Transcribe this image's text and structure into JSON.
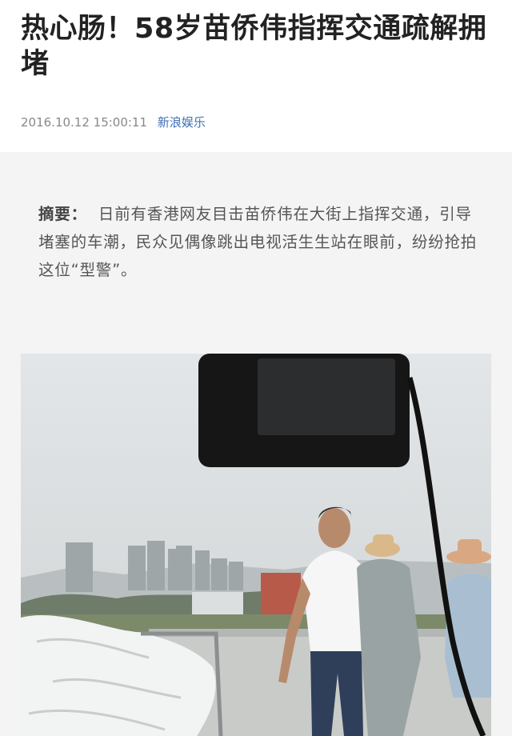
{
  "article": {
    "title": "热心肠！58岁苗侨伟指挥交通疏解拥堵",
    "datetime": "2016.10.12 15:00:11",
    "source": "新浪娱乐",
    "summary_label": "摘要：",
    "summary_text": "日前有香港网友目击苗侨伟在大街上指挥交通，引导堵塞的车潮，民众见偶像跳出电视活生生站在眼前，纷纷抢拍这位“型警”。"
  }
}
